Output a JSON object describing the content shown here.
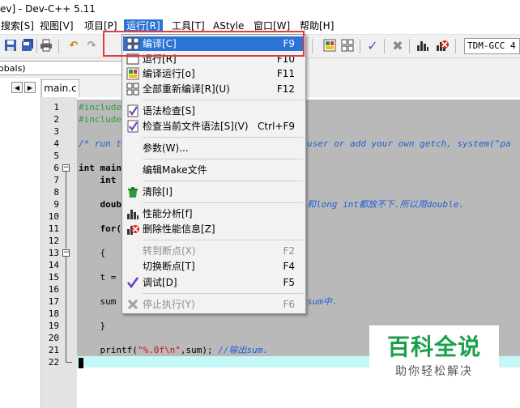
{
  "window": {
    "title": "ev] - Dev-C++ 5.11"
  },
  "menubar": {
    "items": [
      "搜索[S]",
      "视图[V]",
      "项目[P]",
      "运行[R]",
      "工具[T]",
      "AStyle",
      "窗口[W]",
      "帮助[H]"
    ],
    "active_index": 3
  },
  "toolbar": {
    "compiler": "TDM-GCC 4"
  },
  "scope": {
    "label": "lobals)"
  },
  "tabs": [
    {
      "label": "main.c"
    }
  ],
  "run_menu": {
    "items": [
      {
        "label": "编译[C]",
        "shortcut": "F9",
        "icon": "compile-icon",
        "highlighted": true,
        "enabled": true
      },
      {
        "label": "运行[R]",
        "shortcut": "F10",
        "icon": "run-icon",
        "enabled": true
      },
      {
        "label": "编译运行[o]",
        "shortcut": "F11",
        "icon": "compile-run-icon",
        "enabled": true
      },
      {
        "label": "全部重新编译[R](U)",
        "shortcut": "F12",
        "icon": "rebuild-all-icon",
        "enabled": true
      },
      {
        "label": "语法检查[S]",
        "shortcut": "",
        "icon": "syntax-check-icon",
        "enabled": true
      },
      {
        "label": "检查当前文件语法[S](V)",
        "shortcut": "Ctrl+F9",
        "icon": "syntax-check-file-icon",
        "enabled": true
      },
      {
        "label": "参数(W)...",
        "shortcut": "",
        "icon": "",
        "enabled": true
      },
      {
        "label": "编辑Make文件",
        "shortcut": "",
        "icon": "",
        "enabled": true
      },
      {
        "label": "清除[I]",
        "shortcut": "",
        "icon": "clean-icon",
        "enabled": true
      },
      {
        "label": "性能分析[f]",
        "shortcut": "",
        "icon": "profile-icon",
        "enabled": true
      },
      {
        "label": "删除性能信息[Z]",
        "shortcut": "",
        "icon": "delete-profile-icon",
        "enabled": true
      },
      {
        "label": "转到断点(X)",
        "shortcut": "F2",
        "icon": "",
        "enabled": false
      },
      {
        "label": "切换断点[T]",
        "shortcut": "F4",
        "icon": "",
        "enabled": true
      },
      {
        "label": "调试[D]",
        "shortcut": "F5",
        "icon": "debug-check-icon",
        "enabled": true
      },
      {
        "label": "停止执行(Y)",
        "shortcut": "F6",
        "icon": "stop-icon",
        "enabled": false
      }
    ]
  },
  "editor": {
    "line_numbers": [
      "1",
      "2",
      "3",
      "4",
      "5",
      "6",
      "7",
      "8",
      "9",
      "10",
      "11",
      "12",
      "13",
      "14",
      "15",
      "16",
      "17",
      "18",
      "19",
      "20",
      "21",
      "22"
    ],
    "code": {
      "l1": "#include",
      "l2": "#include",
      "l4a": "/* run t",
      "l4b": "user or add your own getch, system(\"pa",
      "l6": "int main",
      "l7": "    int ",
      "l9a": "    doub",
      "l9b": "和long int都放不下.所以用double.",
      "l11": "    for(",
      "l13": "    {",
      "l15": "    t = ",
      "l17a": "    sum ",
      "l17b": "sum中.",
      "l19": "    }",
      "l21a": "    printf(",
      "l21b": "\"%.0f\\n\"",
      "l21c": ",sum); ",
      "l21d": "//输出sum."
    }
  },
  "watermark": {
    "title": "百科全说",
    "subtitle": "助你轻松解决"
  }
}
